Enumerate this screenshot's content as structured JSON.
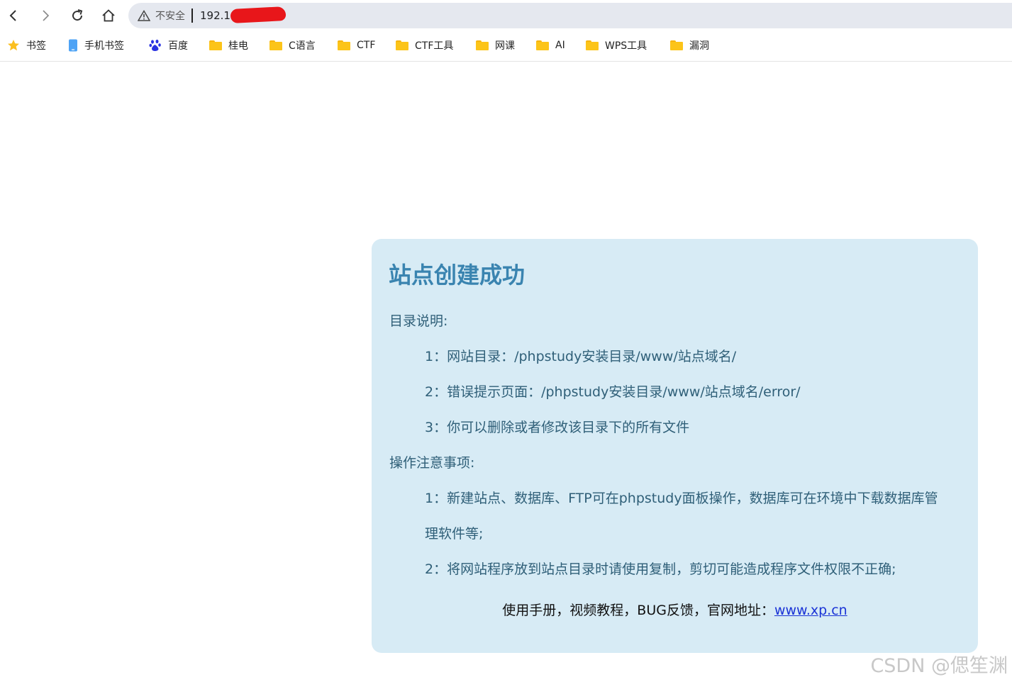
{
  "browser": {
    "security_label": "不安全",
    "url_visible": "192.1"
  },
  "bookmarks": [
    {
      "label": "书签",
      "icon": "star-icon"
    },
    {
      "label": "手机书签",
      "icon": "phone-icon"
    },
    {
      "label": "百度",
      "icon": "baidu-paw-icon"
    },
    {
      "label": "桂电",
      "icon": "folder-icon"
    },
    {
      "label": "C语言",
      "icon": "folder-icon"
    },
    {
      "label": "CTF",
      "icon": "folder-icon"
    },
    {
      "label": "CTF工具",
      "icon": "folder-icon"
    },
    {
      "label": "网课",
      "icon": "folder-icon"
    },
    {
      "label": "AI",
      "icon": "folder-icon"
    },
    {
      "label": "WPS工具",
      "icon": "folder-icon"
    },
    {
      "label": "漏洞",
      "icon": "folder-icon"
    }
  ],
  "card": {
    "title": "站点创建成功",
    "dir_heading": "目录说明:",
    "dir_items": [
      "1：网站目录：/phpstudy安装目录/www/站点域名/",
      "2：错误提示页面：/phpstudy安装目录/www/站点域名/error/",
      "3：你可以删除或者修改该目录下的所有文件"
    ],
    "ops_heading": "操作注意事项:",
    "ops_item1_line1": "1：新建站点、数据库、FTP可在phpstudy面板操作，数据库可在环境中下载数据库管",
    "ops_item1_line2": "理软件等;",
    "ops_item2": "2：将网站程序放到站点目录时请使用复制，剪切可能造成程序文件权限不正确;",
    "footer_text": "使用手册，视频教程，BUG反馈，官网地址：",
    "footer_link": "www.xp.cn"
  },
  "watermark": "CSDN @偲笙渊",
  "colors": {
    "card_bg": "#d7ebf5",
    "title": "#3a84b0",
    "body_text": "#2f5f78",
    "link": "#1a33d6",
    "address_bar": "#e5e8ef",
    "folder": "#fcc419"
  }
}
